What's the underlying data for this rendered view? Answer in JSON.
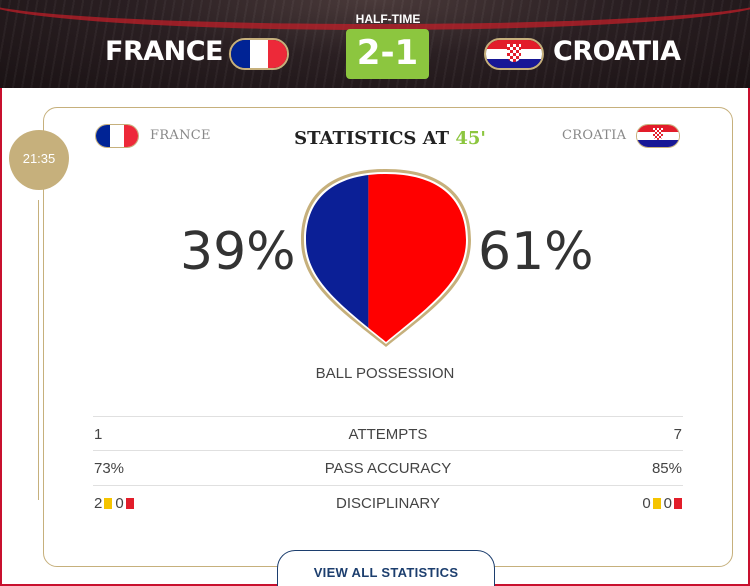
{
  "match": {
    "status": "HALF-TIME",
    "score": "2-1",
    "home": {
      "name": "FRANCE",
      "flag_colors": [
        "#002395",
        "#ffffff",
        "#ed2939"
      ]
    },
    "away": {
      "name": "CROATIA",
      "flag_colors": [
        "#e21d2a",
        "#ffffff",
        "#171796"
      ]
    }
  },
  "card": {
    "time": "21:35",
    "home_name": "FRANCE",
    "away_name": "CROATIA",
    "title": "STATISTICS AT",
    "minute": "45'"
  },
  "possession": {
    "home_pct": "39%",
    "away_pct": "61%",
    "home_value": 39,
    "away_value": 61,
    "home_color": "#0b1f96",
    "away_color": "#ff0000",
    "label": "BALL POSSESSION"
  },
  "stats": [
    {
      "home": "1",
      "label": "ATTEMPTS",
      "away": "7"
    },
    {
      "home": "73%",
      "label": "PASS ACCURACY",
      "away": "85%"
    }
  ],
  "disciplinary": {
    "label": "DISCIPLINARY",
    "home_yellow": "2",
    "home_red": "0",
    "away_yellow": "0",
    "away_red": "0"
  },
  "view_all_label": "VIEW ALL STATISTICS",
  "colors": {
    "accent_green": "#8cc63f",
    "gold": "#c6b07c",
    "navy": "#1c3e6e",
    "border_red": "#c8102e"
  }
}
